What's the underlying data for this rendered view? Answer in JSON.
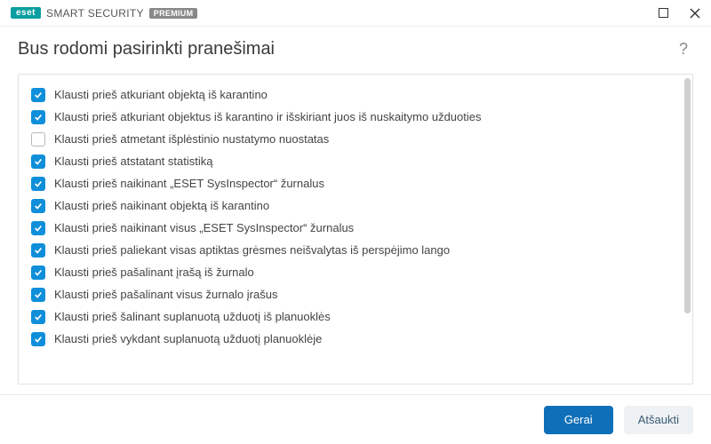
{
  "brand": {
    "eset": "eset",
    "main": "SMART SECURITY",
    "badge": "PREMIUM"
  },
  "title": "Bus rodomi pasirinkti pranešimai",
  "items": [
    {
      "checked": true,
      "label": "Klausti prieš atkuriant objektą iš karantino"
    },
    {
      "checked": true,
      "label": "Klausti prieš atkuriant objektus iš karantino ir išskiriant juos iš nuskaitymo užduoties"
    },
    {
      "checked": false,
      "label": "Klausti prieš atmetant išplėstinio nustatymo nuostatas"
    },
    {
      "checked": true,
      "label": "Klausti prieš atstatant statistiką"
    },
    {
      "checked": true,
      "label": "Klausti prieš naikinant „ESET SysInspector“ žurnalus"
    },
    {
      "checked": true,
      "label": "Klausti prieš naikinant objektą iš karantino"
    },
    {
      "checked": true,
      "label": "Klausti prieš naikinant visus „ESET SysInspector“ žurnalus"
    },
    {
      "checked": true,
      "label": "Klausti prieš paliekant visas aptiktas grėsmes neišvalytas iš perspėjimo lango"
    },
    {
      "checked": true,
      "label": "Klausti prieš pašalinant įrašą iš žurnalo"
    },
    {
      "checked": true,
      "label": "Klausti prieš pašalinant visus žurnalo įrašus"
    },
    {
      "checked": true,
      "label": "Klausti prieš šalinant suplanuotą užduotį iš planuoklės"
    },
    {
      "checked": true,
      "label": "Klausti prieš vykdant suplanuotą užduotį planuoklėje"
    }
  ],
  "buttons": {
    "ok": "Gerai",
    "cancel": "Atšaukti"
  }
}
